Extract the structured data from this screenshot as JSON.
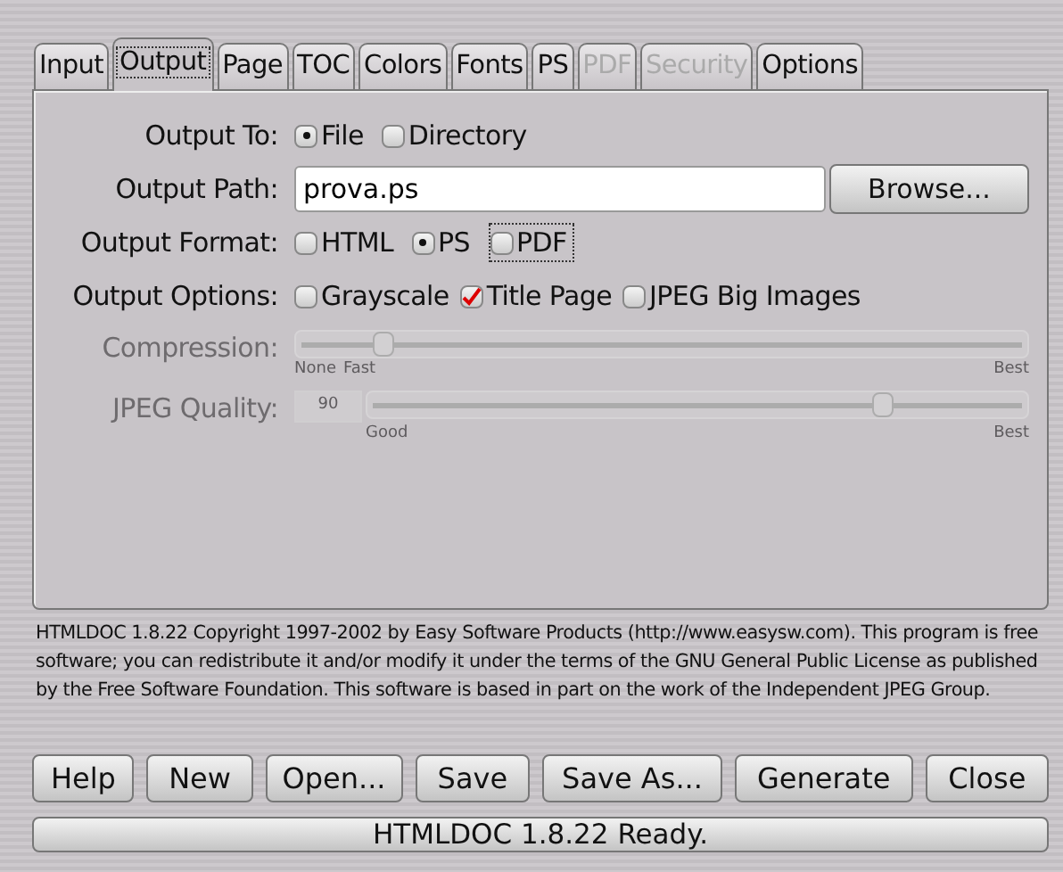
{
  "tabs": [
    {
      "label": "Input",
      "selected": false,
      "disabled": false
    },
    {
      "label": "Output",
      "selected": true,
      "disabled": false
    },
    {
      "label": "Page",
      "selected": false,
      "disabled": false
    },
    {
      "label": "TOC",
      "selected": false,
      "disabled": false
    },
    {
      "label": "Colors",
      "selected": false,
      "disabled": false
    },
    {
      "label": "Fonts",
      "selected": false,
      "disabled": false
    },
    {
      "label": "PS",
      "selected": false,
      "disabled": false
    },
    {
      "label": "PDF",
      "selected": false,
      "disabled": true
    },
    {
      "label": "Security",
      "selected": false,
      "disabled": true
    },
    {
      "label": "Options",
      "selected": false,
      "disabled": false
    }
  ],
  "fields": [
    {
      "kind": "radio",
      "label": "Output To:",
      "disabled": false,
      "options": [
        {
          "label": "File",
          "selected": true,
          "focused": false
        },
        {
          "label": "Directory",
          "selected": false,
          "focused": false
        }
      ]
    },
    {
      "kind": "path",
      "label": "Output Path:",
      "disabled": false,
      "value": "prova.ps",
      "button": "Browse..."
    },
    {
      "kind": "radio",
      "label": "Output Format:",
      "disabled": false,
      "options": [
        {
          "label": "HTML",
          "selected": false,
          "focused": false
        },
        {
          "label": "PS",
          "selected": true,
          "focused": false
        },
        {
          "label": "PDF",
          "selected": false,
          "focused": true
        }
      ]
    },
    {
      "kind": "checks",
      "label": "Output Options:",
      "disabled": false,
      "options": [
        {
          "label": "Grayscale",
          "checked": false
        },
        {
          "label": "Title Page",
          "checked": true
        },
        {
          "label": "JPEG Big Images",
          "checked": false
        }
      ]
    },
    {
      "kind": "slider",
      "label": "Compression:",
      "disabled": true,
      "level": 0.12,
      "ticks": [
        "None",
        "Fast",
        "Best"
      ]
    },
    {
      "kind": "slider",
      "label": "JPEG Quality:",
      "disabled": true,
      "value": "90",
      "level": 0.78,
      "ticks": [
        "Good",
        "Best"
      ]
    }
  ],
  "about": "HTMLDOC 1.8.22 Copyright 1997-2002 by Easy Software Products (http://www.easysw.com). This program is free software; you can redistribute it and/or modify it under the terms of the GNU General Public License as published by the Free Software Foundation. This software is based in part on the work of the Independent JPEG Group.",
  "buttons": [
    "Help",
    "New",
    "Open...",
    "Save",
    "Save As...",
    "Generate",
    "Close"
  ],
  "status_bar": "HTMLDOC 1.8.22 Ready."
}
